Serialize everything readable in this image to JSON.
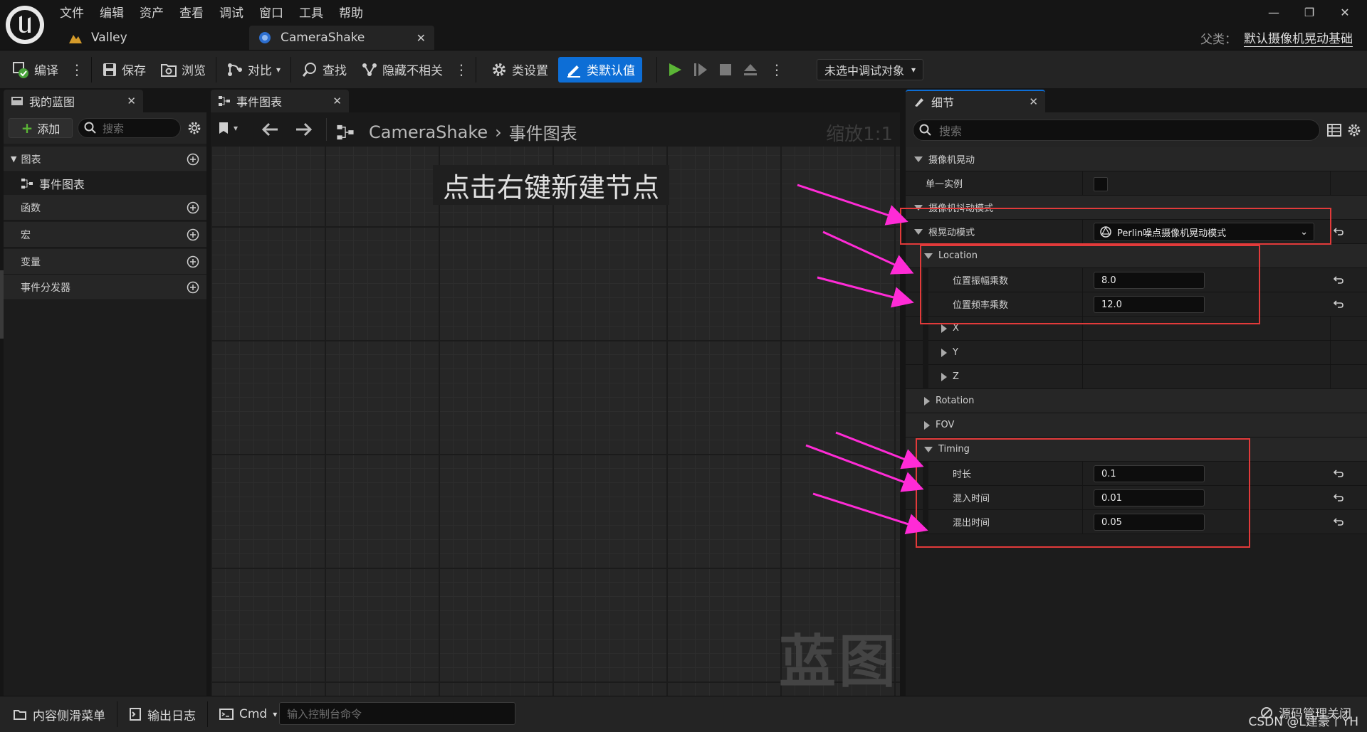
{
  "menu": [
    "文件",
    "编辑",
    "资产",
    "查看",
    "调试",
    "窗口",
    "工具",
    "帮助"
  ],
  "tabs": [
    {
      "label": "Valley"
    },
    {
      "label": "CameraShake"
    }
  ],
  "parent": {
    "label": "父类：",
    "value": "默认摄像机晃动基础"
  },
  "toolbar": {
    "compile": "编译",
    "save": "保存",
    "browse": "浏览",
    "diff": "对比",
    "find": "查找",
    "hide_unrelated": "隐藏不相关",
    "class_settings": "类设置",
    "class_defaults": "类默认值",
    "debug_object": "未选中调试对象"
  },
  "my_blueprint": {
    "tab_label": "我的蓝图",
    "add_label": "添加",
    "search_placeholder": "搜索",
    "categories": {
      "graphs": "图表",
      "event_graph": "事件图表",
      "functions": "函数",
      "macros": "宏",
      "variables": "变量",
      "dispatchers": "事件分发器"
    }
  },
  "graph_panel": {
    "tab_label": "事件图表",
    "crumb_root": "CameraShake",
    "crumb_child": "事件图表",
    "zoom": "缩放1:1",
    "hint": "点击右键新建节点",
    "watermark": "蓝图"
  },
  "details": {
    "tab_label": "细节",
    "search_placeholder": "搜索",
    "rows": {
      "cat_camera_shake": "摄像机晃动",
      "single_instance": "单一实例",
      "cat_shake_pattern": "摄像机抖动模式",
      "root_shake_pattern": "根晃动模式",
      "root_shake_pattern_value": "Perlin噪点摄像机晃动模式",
      "location": "Location",
      "loc_amp": "位置振幅乘数",
      "loc_amp_value": "8.0",
      "loc_freq": "位置频率乘数",
      "loc_freq_value": "12.0",
      "x": "X",
      "y": "Y",
      "z": "Z",
      "rotation": "Rotation",
      "fov": "FOV",
      "timing": "Timing",
      "duration": "时长",
      "duration_value": "0.1",
      "blend_in": "混入时间",
      "blend_in_value": "0.01",
      "blend_out": "混出时间",
      "blend_out_value": "0.05"
    }
  },
  "bottom": {
    "content_drawer": "内容侧滑菜单",
    "output_log": "输出日志",
    "cmd": "Cmd",
    "cmd_placeholder": "输入控制台命令",
    "source_control": "源码管理关闭"
  },
  "credit": "CSDN @L建豪丫YH",
  "colors": {
    "accent_blue": "#0d6ed6",
    "annotation_red": "#e23a3a",
    "annotation_magenta": "#ff2bd6",
    "play_green": "#5bb536"
  }
}
